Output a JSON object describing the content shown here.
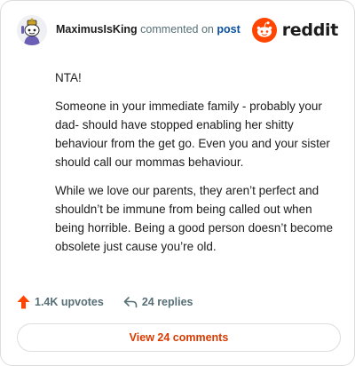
{
  "header": {
    "username": "MaximusIsKing",
    "commented_text": "commented on",
    "post_link_label": "post",
    "logo_text": "reddit",
    "avatar_icon": "snoo-avatar-icon",
    "logo_icon": "reddit-snoo-icon"
  },
  "comment": {
    "paragraphs": [
      "NTA!",
      "Someone in your immediate family - probably your dad- should have stopped enabling her shitty behaviour from the get go. Even you and your sister should call our mommas behaviour.",
      "While we love our parents, they aren’t perfect and shouldn’t be immune from being called out when being horrible. Being a good person doesn’t become obsolete just cause you’re old."
    ]
  },
  "actions": {
    "upvotes_label": "1.4K upvotes",
    "replies_label": "24 replies",
    "upvote_icon": "upvote-arrow-icon",
    "reply_icon": "reply-arrow-icon"
  },
  "footer": {
    "view_comments_label": "View 24 comments"
  },
  "colors": {
    "brand": "#ff4500",
    "link": "#0a4f9e",
    "muted": "#576f76",
    "view_button_text": "#d93a00"
  }
}
